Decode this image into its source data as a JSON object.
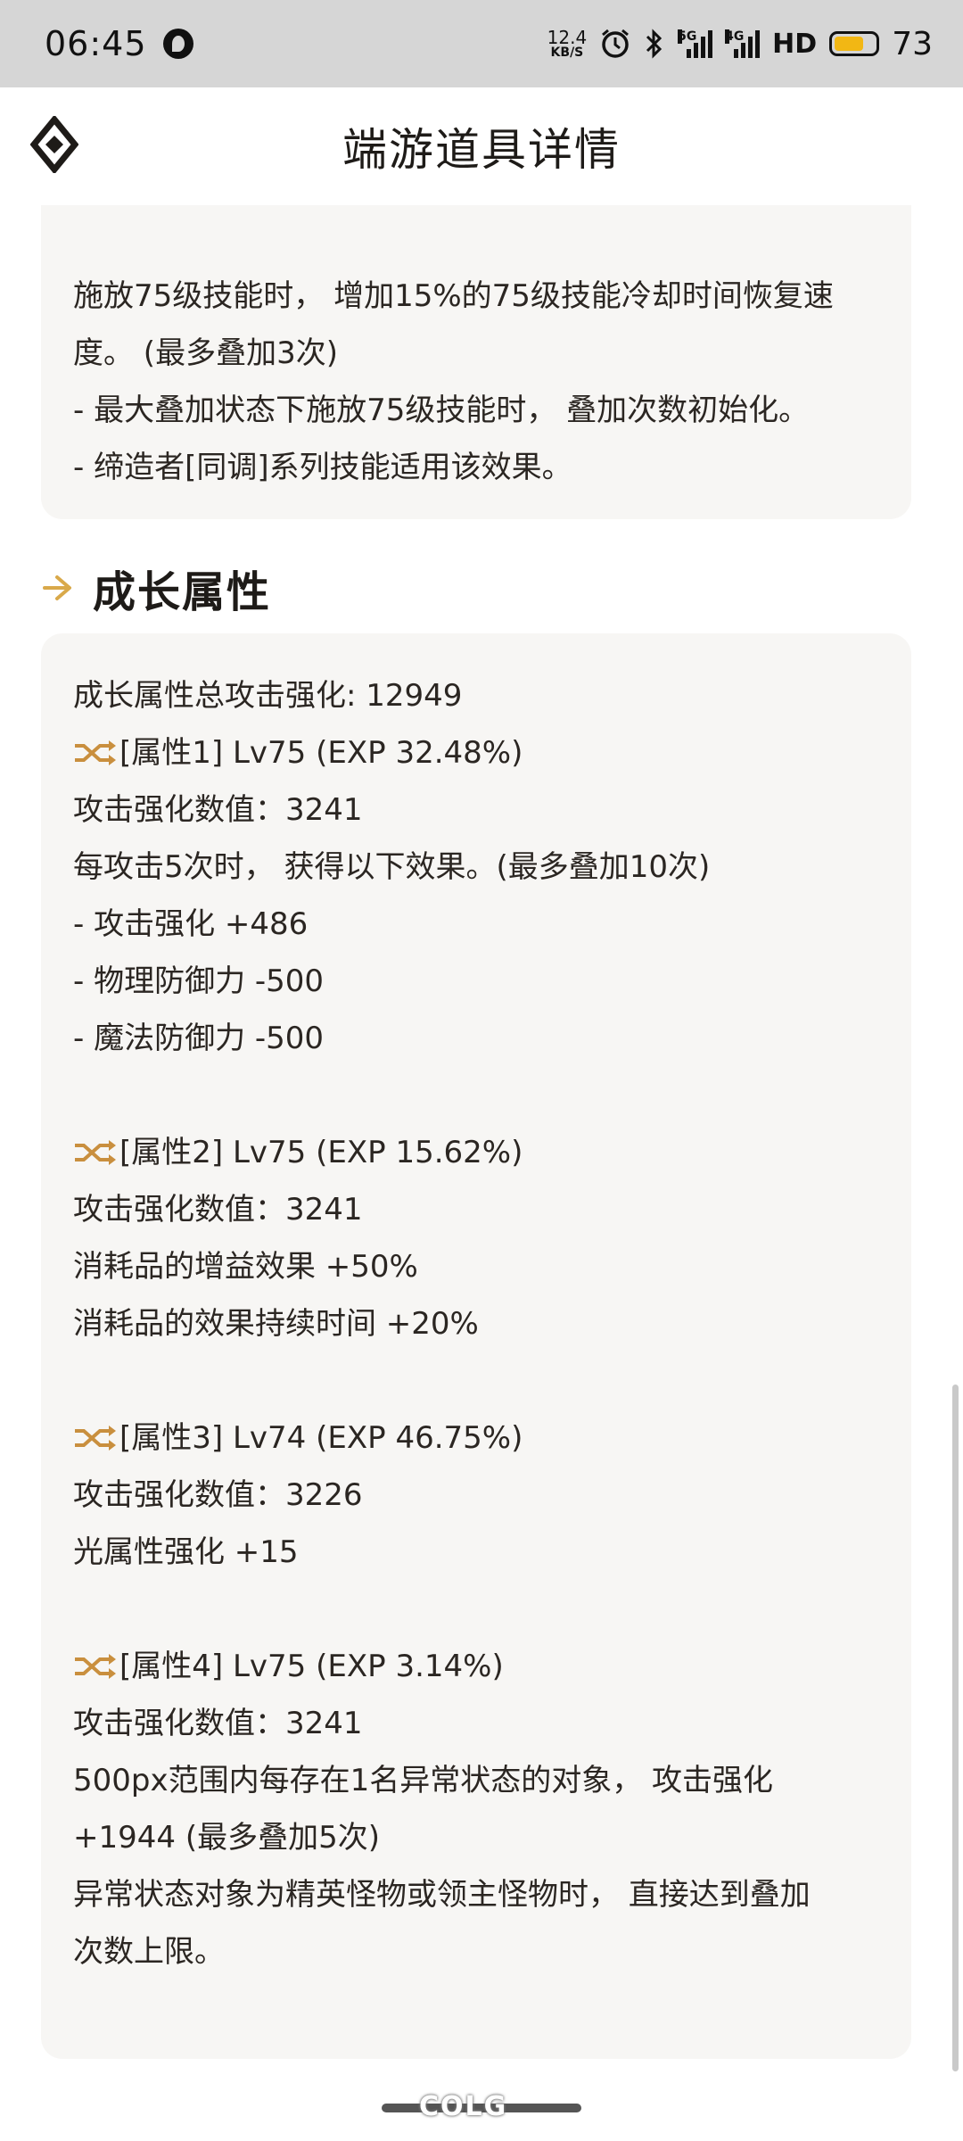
{
  "status_bar": {
    "time": "06:45",
    "net_speed_value": "12.4",
    "net_speed_unit": "KB/S",
    "signal_1_label": "5G",
    "signal_2_label": "4G",
    "hd_label": "HD",
    "battery_percent": "73",
    "battery_level": 0.73,
    "battery_color": "#f2b714"
  },
  "header": {
    "title": "端游道具详情",
    "logo_icon": "diamond-logo-icon"
  },
  "effect_card": {
    "lines": [
      "施放75级技能时， 增加15%的75级技能冷却时间恢复速",
      "度。 (最多叠加3次)",
      "- 最大叠加状态下施放75级技能时， 叠加次数初始化。",
      "- 缔造者[同调]系列技能适用该效果。"
    ]
  },
  "section": {
    "title": "成长属性",
    "accent_color": "#d9a94a"
  },
  "growth_card": {
    "total": "成长属性总攻击强化: 12949",
    "props": [
      {
        "head": "[属性1] Lv75 (EXP 32.48%)",
        "lines": [
          "攻击强化数值：3241",
          "每攻击5次时， 获得以下效果。(最多叠加10次)",
          "- 攻击强化 +486",
          "- 物理防御力 -500",
          "- 魔法防御力 -500"
        ]
      },
      {
        "head": "[属性2] Lv75 (EXP 15.62%)",
        "lines": [
          "攻击强化数值：3241",
          "消耗品的增益效果 +50%",
          "消耗品的效果持续时间 +20%"
        ]
      },
      {
        "head": "[属性3] Lv74 (EXP 46.75%)",
        "lines": [
          "攻击强化数值：3226",
          "光属性强化 +15"
        ]
      },
      {
        "head": "[属性4] Lv75 (EXP 3.14%)",
        "lines": [
          "攻击强化数值：3241",
          "500px范围内每存在1名异常状态的对象， 攻击强化",
          "+1944 (最多叠加5次)",
          "异常状态对象为精英怪物或领主怪物时， 直接达到叠加",
          "次数上限。"
        ]
      }
    ],
    "icon_color": "#c98f3e"
  },
  "watermark": {
    "text": "COLG"
  }
}
